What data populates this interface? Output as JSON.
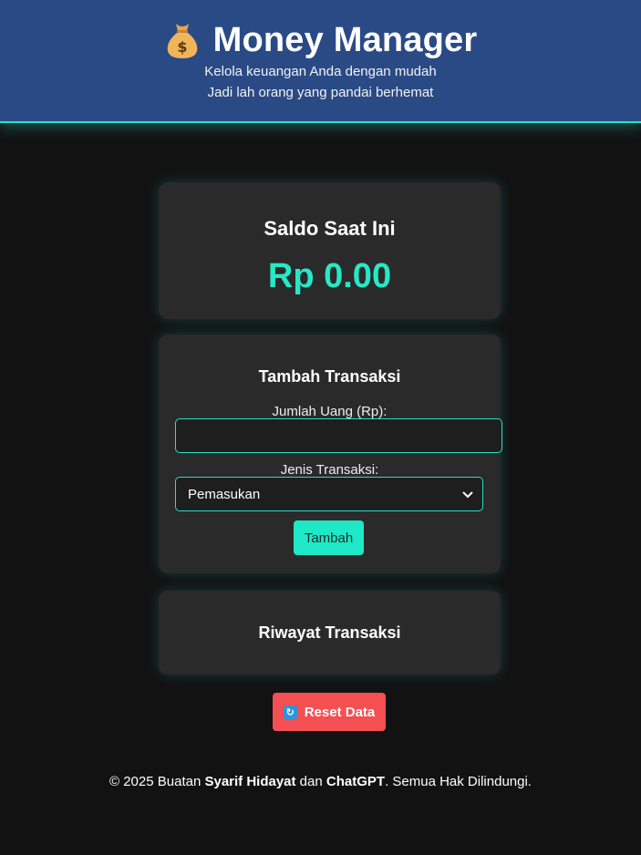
{
  "header": {
    "icon": "money-bag-icon",
    "title": "Money Manager",
    "subtitle_1": "Kelola keuangan Anda dengan mudah",
    "subtitle_2": "Jadi lah orang yang pandai berhemat"
  },
  "balance": {
    "label": "Saldo Saat Ini",
    "value": "Rp 0.00"
  },
  "form": {
    "title": "Tambah Transaksi",
    "amount_label": "Jumlah Uang (Rp):",
    "amount_value": "",
    "type_label": "Jenis Transaksi:",
    "type_selected": "Pemasukan",
    "submit_label": "Tambah"
  },
  "history": {
    "title": "Riwayat Transaksi"
  },
  "reset": {
    "icon": "refresh-icon",
    "label": "Reset Data"
  },
  "footer": {
    "prefix": "© 2025 Buatan ",
    "author": "Syarif Hidayat",
    "middle": " dan ",
    "coauthor": "ChatGPT",
    "suffix": ". Semua Hak Dilindungi."
  },
  "colors": {
    "header_bg": "#2a4a86",
    "accent": "#27e0c4",
    "card_bg": "#2a2a2a",
    "page_bg": "#121212",
    "danger": "#f44f52"
  }
}
